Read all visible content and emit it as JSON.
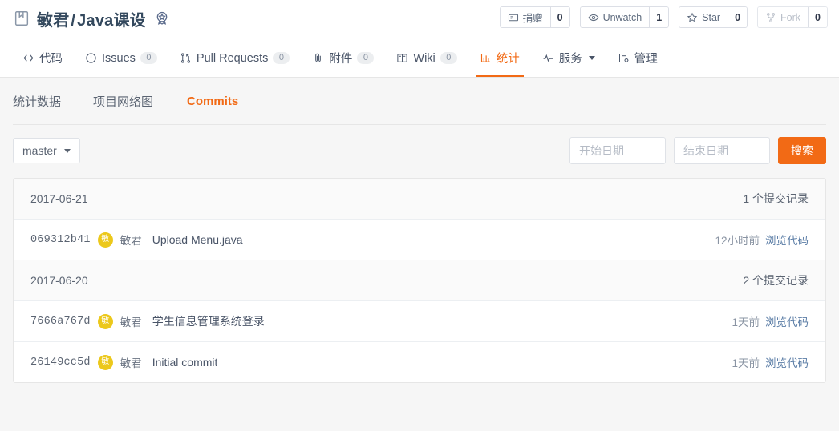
{
  "header": {
    "repo_owner": "敏君",
    "separator": "/",
    "repo_name": "Java课设",
    "actions": [
      {
        "label": "捐赠",
        "count": "0",
        "icon": "donate-icon",
        "disabled": false
      },
      {
        "label": "Unwatch",
        "count": "1",
        "icon": "eye-icon",
        "disabled": false
      },
      {
        "label": "Star",
        "count": "0",
        "icon": "star-icon",
        "disabled": false
      },
      {
        "label": "Fork",
        "count": "0",
        "icon": "fork-icon",
        "disabled": true
      }
    ]
  },
  "nav": {
    "items": [
      {
        "label": "代码",
        "count": null,
        "icon": "code-icon",
        "active": false,
        "dropdown": false
      },
      {
        "label": "Issues",
        "count": "0",
        "icon": "issue-circle-icon",
        "active": false,
        "dropdown": false
      },
      {
        "label": "Pull Requests",
        "count": "0",
        "icon": "pull-request-icon",
        "active": false,
        "dropdown": false
      },
      {
        "label": "附件",
        "count": "0",
        "icon": "paperclip-icon",
        "active": false,
        "dropdown": false
      },
      {
        "label": "Wiki",
        "count": "0",
        "icon": "book-open-icon",
        "active": false,
        "dropdown": false
      },
      {
        "label": "统计",
        "count": null,
        "icon": "bar-chart-icon",
        "active": true,
        "dropdown": false
      },
      {
        "label": "服务",
        "count": null,
        "icon": "pulse-icon",
        "active": false,
        "dropdown": true
      },
      {
        "label": "管理",
        "count": null,
        "icon": "settings-list-icon",
        "active": false,
        "dropdown": false
      }
    ]
  },
  "sub_nav": {
    "items": [
      {
        "label": "统计数据",
        "active": false
      },
      {
        "label": "项目网络图",
        "active": false
      },
      {
        "label": "Commits",
        "active": true
      }
    ]
  },
  "toolbar": {
    "branch": "master",
    "start_date_placeholder": "开始日期",
    "start_date_value": "",
    "end_date_placeholder": "结束日期",
    "end_date_value": "",
    "search_label": "搜索"
  },
  "commits": {
    "groups": [
      {
        "date": "2017-06-21",
        "count_label": "1 个提交记录",
        "rows": [
          {
            "hash": "069312b41",
            "avatar_initial": "敏",
            "author": "敏君",
            "message": "Upload Menu.java",
            "time": "12小时前",
            "browse_label": "浏览代码"
          }
        ]
      },
      {
        "date": "2017-06-20",
        "count_label": "2 个提交记录",
        "rows": [
          {
            "hash": "7666a767d",
            "avatar_initial": "敏",
            "author": "敏君",
            "message": "学生信息管理系统登录",
            "time": "1天前",
            "browse_label": "浏览代码"
          },
          {
            "hash": "26149cc5d",
            "avatar_initial": "敏",
            "author": "敏君",
            "message": "Initial commit",
            "time": "1天前",
            "browse_label": "浏览代码"
          }
        ]
      }
    ]
  },
  "colors": {
    "accent": "#f26a15",
    "title": "#34495e",
    "avatar": "#ecc81b",
    "link": "#5b7da6",
    "page_bg": "#f6f6f6"
  }
}
